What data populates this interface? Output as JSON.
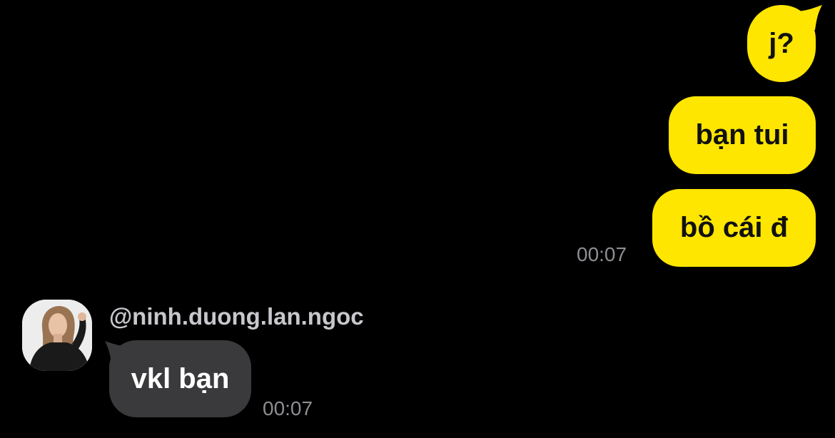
{
  "colors": {
    "background": "#000000",
    "outgoing_bubble": "#FFE600",
    "incoming_bubble": "#3A3A3C",
    "timestamp": "#8E8E93"
  },
  "outgoing": {
    "messages": [
      "j?",
      "bạn tui",
      "bồ cái đ"
    ],
    "time": "00:07"
  },
  "incoming": {
    "username": "@ninh.duong.lan.ngoc",
    "avatar_icon": "profile-photo",
    "message": "vkl bạn",
    "time": "00:07"
  }
}
